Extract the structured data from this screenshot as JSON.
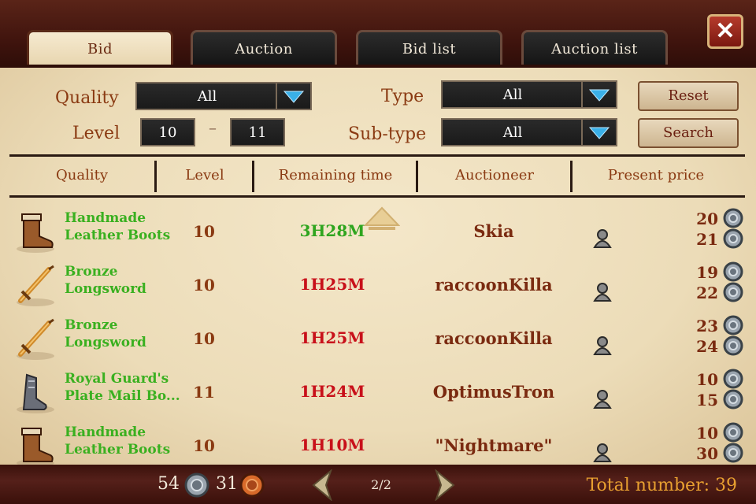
{
  "tabs": [
    {
      "label": "Bid",
      "active": true
    },
    {
      "label": "Auction",
      "active": false
    },
    {
      "label": "Bid list",
      "active": false
    },
    {
      "label": "Auction list",
      "active": false
    }
  ],
  "close_label": "✕",
  "filters": {
    "quality_label": "Quality",
    "quality_value": "All",
    "type_label": "Type",
    "type_value": "All",
    "level_label": "Level",
    "level_min": "10",
    "level_dash": "–",
    "level_max": "11",
    "subtype_label": "Sub-type",
    "subtype_value": "All",
    "reset_label": "Reset",
    "search_label": "Search"
  },
  "columns": [
    "Quality",
    "Level",
    "Remaining time",
    "Auctioneer",
    "Present price"
  ],
  "rows": [
    {
      "name1": "Handmade",
      "name2": "Leather Boots",
      "icon": "boots-icon",
      "level": "10",
      "time": "3H28M",
      "time_color": "#2fa51f",
      "auctioneer": "Skia",
      "price1": "20",
      "price2": "21"
    },
    {
      "name1": "Bronze",
      "name2": "Longsword",
      "icon": "sword-icon",
      "level": "10",
      "time": "1H25M",
      "time_color": "#c8101a",
      "auctioneer": "raccoonKilla",
      "price1": "19",
      "price2": "22"
    },
    {
      "name1": "Bronze",
      "name2": "Longsword",
      "icon": "sword-icon",
      "level": "10",
      "time": "1H25M",
      "time_color": "#c8101a",
      "auctioneer": "raccoonKilla",
      "price1": "23",
      "price2": "24"
    },
    {
      "name1": "Royal Guard's",
      "name2": "Plate Mail Bo...",
      "icon": "plate-boots-icon",
      "level": "11",
      "time": "1H24M",
      "time_color": "#c8101a",
      "auctioneer": "OptimusTron",
      "price1": "10",
      "price2": "15"
    },
    {
      "name1": "Handmade",
      "name2": "Leather Boots",
      "icon": "boots-icon",
      "level": "10",
      "time": "1H10M",
      "time_color": "#c8101a",
      "auctioneer": "\"Nightmare\"",
      "price1": "10",
      "price2": "30"
    }
  ],
  "footer": {
    "silver": "54",
    "copper": "31",
    "page": "2/2",
    "total": "Total number: 39"
  },
  "colors": {
    "accent": "#8a3a12",
    "green_name": "#3ab020",
    "red_time": "#c8101a",
    "frame": "#4a1a12"
  }
}
